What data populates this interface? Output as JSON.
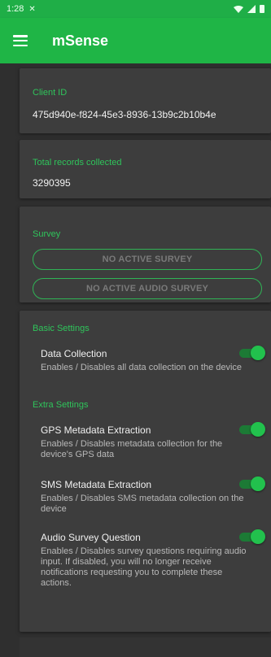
{
  "status_bar": {
    "time": "1:28",
    "notification_icon": "x-notification-icon",
    "wifi_icon": "wifi-icon",
    "signal_icon": "signal-icon",
    "battery_icon": "battery-icon"
  },
  "app_bar": {
    "title": "mSense",
    "menu_icon": "hamburger-menu-icon",
    "color": "#1fb546"
  },
  "client": {
    "label": "Client ID",
    "value": "475d940e-f824-45e3-8936-13b9c2b10b4e"
  },
  "records": {
    "label": "Total records collected",
    "value": "3290395"
  },
  "survey": {
    "label": "Survey",
    "active_survey_button": "NO ACTIVE SURVEY",
    "active_audio_button": "NO ACTIVE AUDIO SURVEY"
  },
  "settings": {
    "basic_label": "Basic Settings",
    "extra_label": "Extra Settings",
    "data_collection": {
      "title": "Data Collection",
      "description": "Enables / Disables all data collection on the device",
      "enabled": true
    },
    "gps": {
      "title": "GPS Metadata Extraction",
      "description": "Enables / Disables metadata collection for the device's GPS data",
      "enabled": true
    },
    "sms": {
      "title": "SMS Metadata Extraction",
      "description": "Enables / Disables SMS metadata collection on the device",
      "enabled": true
    },
    "audio": {
      "title": "Audio Survey Question",
      "description": "Enables / Disables survey questions requiring audio input. If disabled, you will no longer receive notifications requesting you to complete these actions.",
      "enabled": true
    }
  },
  "colors": {
    "accent": "#2fc45b",
    "card_bg": "#3d3d3d",
    "page_bg": "#2f2f2f"
  }
}
